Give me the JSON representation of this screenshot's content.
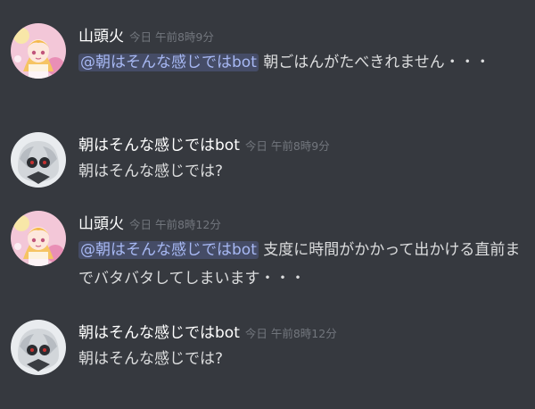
{
  "messages": [
    {
      "user": "山頭火",
      "timestamp": "今日 午前8時9分",
      "mention": "@朝はそんな感じではbot",
      "text": " 朝ごはんがたべきれません・・・",
      "avatar": "anime-girl-avatar"
    },
    {
      "user": "朝はそんな感じではbot",
      "timestamp": "今日 午前8時9分",
      "mention": "",
      "text": "朝はそんな感じでは?",
      "avatar": "bot-character-avatar"
    },
    {
      "user": "山頭火",
      "timestamp": "今日 午前8時12分",
      "mention": "@朝はそんな感じではbot",
      "text": " 支度に時間がかかって出かける直前までバタバタしてしまいます・・・",
      "avatar": "anime-girl-avatar"
    },
    {
      "user": "朝はそんな感じではbot",
      "timestamp": "今日 午前8時12分",
      "mention": "",
      "text": "朝はそんな感じでは?",
      "avatar": "bot-character-avatar"
    }
  ],
  "colors": {
    "background": "#36393f",
    "username": "#ffffff",
    "timestamp": "#72767d",
    "text": "#dcddde",
    "mention_bg": "rgba(114,137,218,0.25)",
    "mention_text": "#a7b8f3"
  }
}
